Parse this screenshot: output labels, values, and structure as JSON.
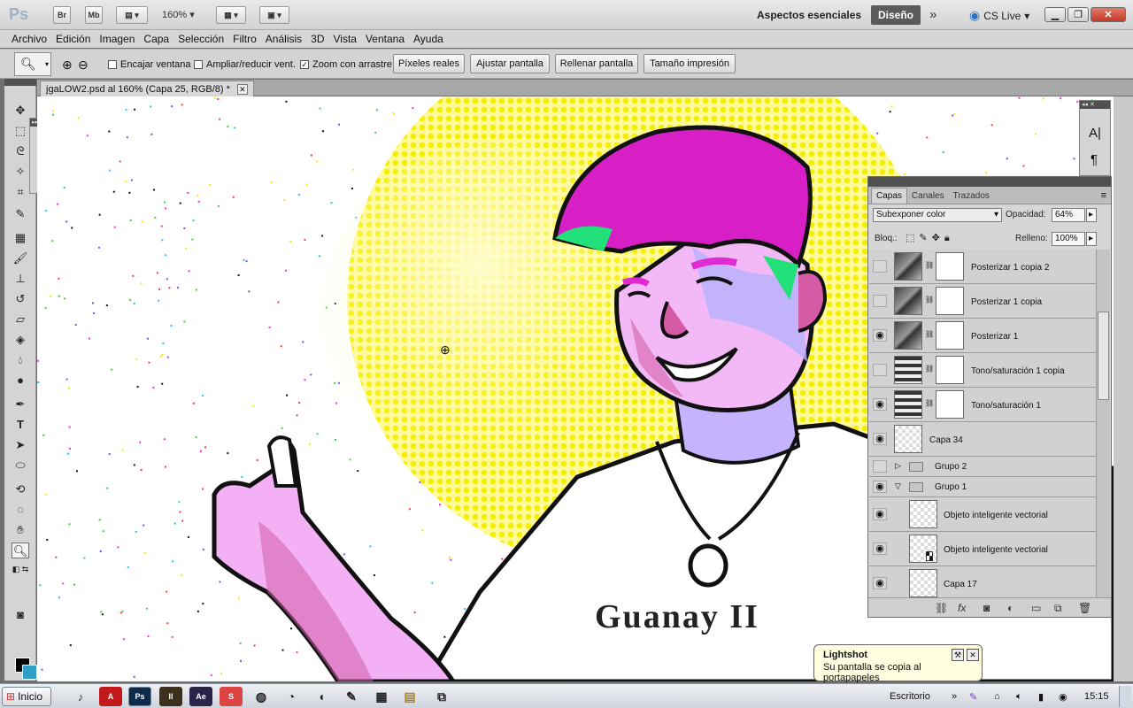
{
  "app": {
    "logo": "Ps",
    "bridge_btn": "Br",
    "minibridge_btn": "Mb",
    "zoom_level": "160%",
    "workspace_label": "Aspectos esenciales",
    "workspace_active": "Diseño",
    "cs_live": "CS Live"
  },
  "menu": [
    "Archivo",
    "Edición",
    "Imagen",
    "Capa",
    "Selección",
    "Filtro",
    "Análisis",
    "3D",
    "Vista",
    "Ventana",
    "Ayuda"
  ],
  "options": {
    "resize_windows": "Encajar ventana",
    "zoom_all": "Ampliar/reducir vent.",
    "scrubby_zoom": "Zoom con arrastre",
    "actual_pixels": "Píxeles reales",
    "fit_screen": "Ajustar pantalla",
    "fill_screen": "Rellenar pantalla",
    "print_size": "Tamaño impresión"
  },
  "document": {
    "tab_title": "jgaLOW2.psd al 160% (Capa 25, RGB/8) *",
    "shirt_text": "Guanay II"
  },
  "layers_panel": {
    "tabs": [
      "Capas",
      "Canales",
      "Trazados"
    ],
    "blend_mode": "Subexponer color",
    "opacity_label": "Opacidad:",
    "opacity": "64%",
    "lock_label": "Bloq.:",
    "fill_label": "Relleno:",
    "fill": "100%",
    "layers": [
      {
        "name": "Posterizar 1 copia 2",
        "visible": false
      },
      {
        "name": "Posterizar 1 copia",
        "visible": false
      },
      {
        "name": "Posterizar 1",
        "visible": true
      },
      {
        "name": "Tono/saturación 1 copia",
        "visible": false
      },
      {
        "name": "Tono/saturación 1",
        "visible": true
      },
      {
        "name": "Capa 34",
        "visible": true
      },
      {
        "name": "Grupo 2",
        "visible": false
      },
      {
        "name": "Grupo 1",
        "visible": true
      },
      {
        "name": "Objeto inteligente vectorial",
        "visible": true
      },
      {
        "name": "Objeto inteligente vectorial",
        "visible": true
      },
      {
        "name": "Capa 17",
        "visible": true
      }
    ]
  },
  "notification": {
    "title": "Lightshot",
    "body": "Su pantalla se copia al portapapeles"
  },
  "taskbar": {
    "start": "Inicio",
    "desktop": "Escritorio",
    "clock": "15:15"
  },
  "colors": {
    "foreground": "#000000",
    "background": "#2f9fc8",
    "halftone_yellow": "#f7f000",
    "hair_magenta": "#d81fc6"
  }
}
